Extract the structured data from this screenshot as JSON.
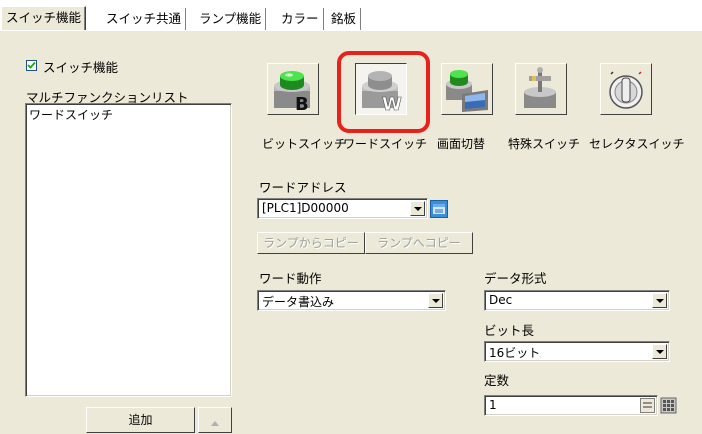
{
  "tabs": [
    {
      "label": "スイッチ機能",
      "active": true
    },
    {
      "label": "スイッチ共通",
      "active": false
    },
    {
      "label": "ランプ機能",
      "active": false
    },
    {
      "label": "カラー",
      "active": false
    },
    {
      "label": "銘板",
      "active": false
    }
  ],
  "switch_function": {
    "checkbox_label": "スイッチ機能",
    "checked": true
  },
  "multi_list": {
    "label": "マルチファンクションリスト",
    "items": [
      "ワードスイッチ"
    ]
  },
  "add_button": "追加",
  "switch_types": [
    {
      "label": "ビットスイッチ",
      "icon": "bit-switch-icon",
      "badge": "B"
    },
    {
      "label": "ワードスイッチ",
      "icon": "word-switch-icon",
      "badge": "W",
      "selected": true
    },
    {
      "label": "画面切替",
      "icon": "screen-change-icon"
    },
    {
      "label": "特殊スイッチ",
      "icon": "special-switch-icon"
    },
    {
      "label": "セレクタスイッチ",
      "icon": "selector-switch-icon"
    }
  ],
  "word_address": {
    "label": "ワードアドレス",
    "value": "[PLC1]D00000"
  },
  "copy_from_lamp": "ランプからコピー",
  "copy_to_lamp": "ランプへコピー",
  "word_action": {
    "label": "ワード動作",
    "value": "データ書込み"
  },
  "data_format": {
    "label": "データ形式",
    "value": "Dec"
  },
  "bit_length": {
    "label": "ビット長",
    "value": "16ビット"
  },
  "constant": {
    "label": "定数",
    "value": "1"
  },
  "colors": {
    "highlight": "#e8211d",
    "panel": "#ece9d8"
  }
}
